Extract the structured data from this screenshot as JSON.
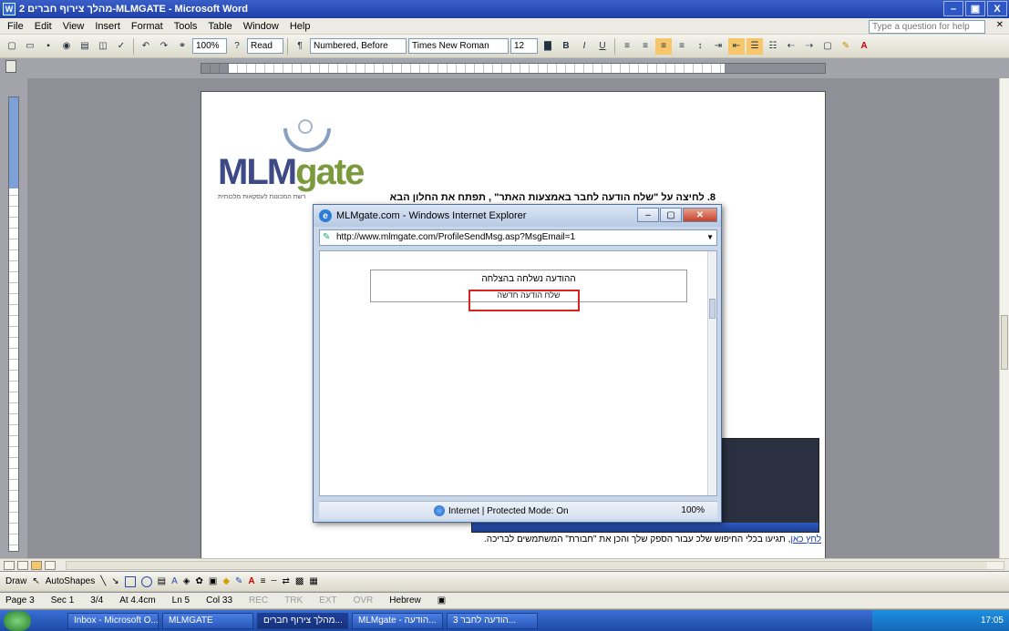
{
  "window": {
    "title": "מהלך צירוף חברים 2-MLMGATE - Microsoft Word",
    "btn_min": "–",
    "btn_max": "▣",
    "btn_close": "X"
  },
  "menu": {
    "items": [
      "File",
      "Edit",
      "View",
      "Insert",
      "Format",
      "Tools",
      "Table",
      "Window",
      "Help"
    ],
    "question_placeholder": "Type a question for help"
  },
  "toolbar": {
    "zoom": "100%",
    "read": "Read",
    "style": "Numbered, Before",
    "font": "Times New Roman",
    "size": "12"
  },
  "document": {
    "logo_mlm": "MLM",
    "logo_gate": "gate",
    "logo_tagline": "רשת המכונות לעסקאות מלכותית",
    "step_text": "8.  לחיצה על \"שלח הודעה לחבר באמצעות האתר\" , תפתח את החלון הבא",
    "bottom_link": "לחץ כאן",
    "bottom_text": ", תגיעו בכלי החיפוש שלכ עבור הספק שלך והכן את \"חבורת\" המשתמשים לבריכה."
  },
  "ie": {
    "title": "MLMgate.com - Windows Internet Explorer",
    "url": "http://www.mlmgate.com/ProfileSendMsg.asp?MsgEmail=1",
    "message_line1": "ההודעה נשלחה בהצלחה",
    "message_line2": "שלח הודעה חדשה",
    "status_zone": "Internet | Protected Mode: On",
    "status_zoom": "100%"
  },
  "drawbar": {
    "draw": "Draw",
    "autoshapes": "AutoShapes"
  },
  "statusbar": {
    "page": "Page 3",
    "sec": "Sec 1",
    "pages": "3/4",
    "at": "At 4.4cm",
    "ln": "Ln 5",
    "col": "Col 33",
    "rec": "REC",
    "trk": "TRK",
    "ext": "EXT",
    "ovr": "OVR",
    "lang": "Hebrew"
  },
  "taskbar": {
    "tasks": [
      "Inbox - Microsoft O...",
      "MLMGATE",
      "מהלך צירוף חברים...",
      "MLMgate - הודעה...",
      "הודעה לחבר 3..."
    ],
    "clock": "17:05"
  }
}
